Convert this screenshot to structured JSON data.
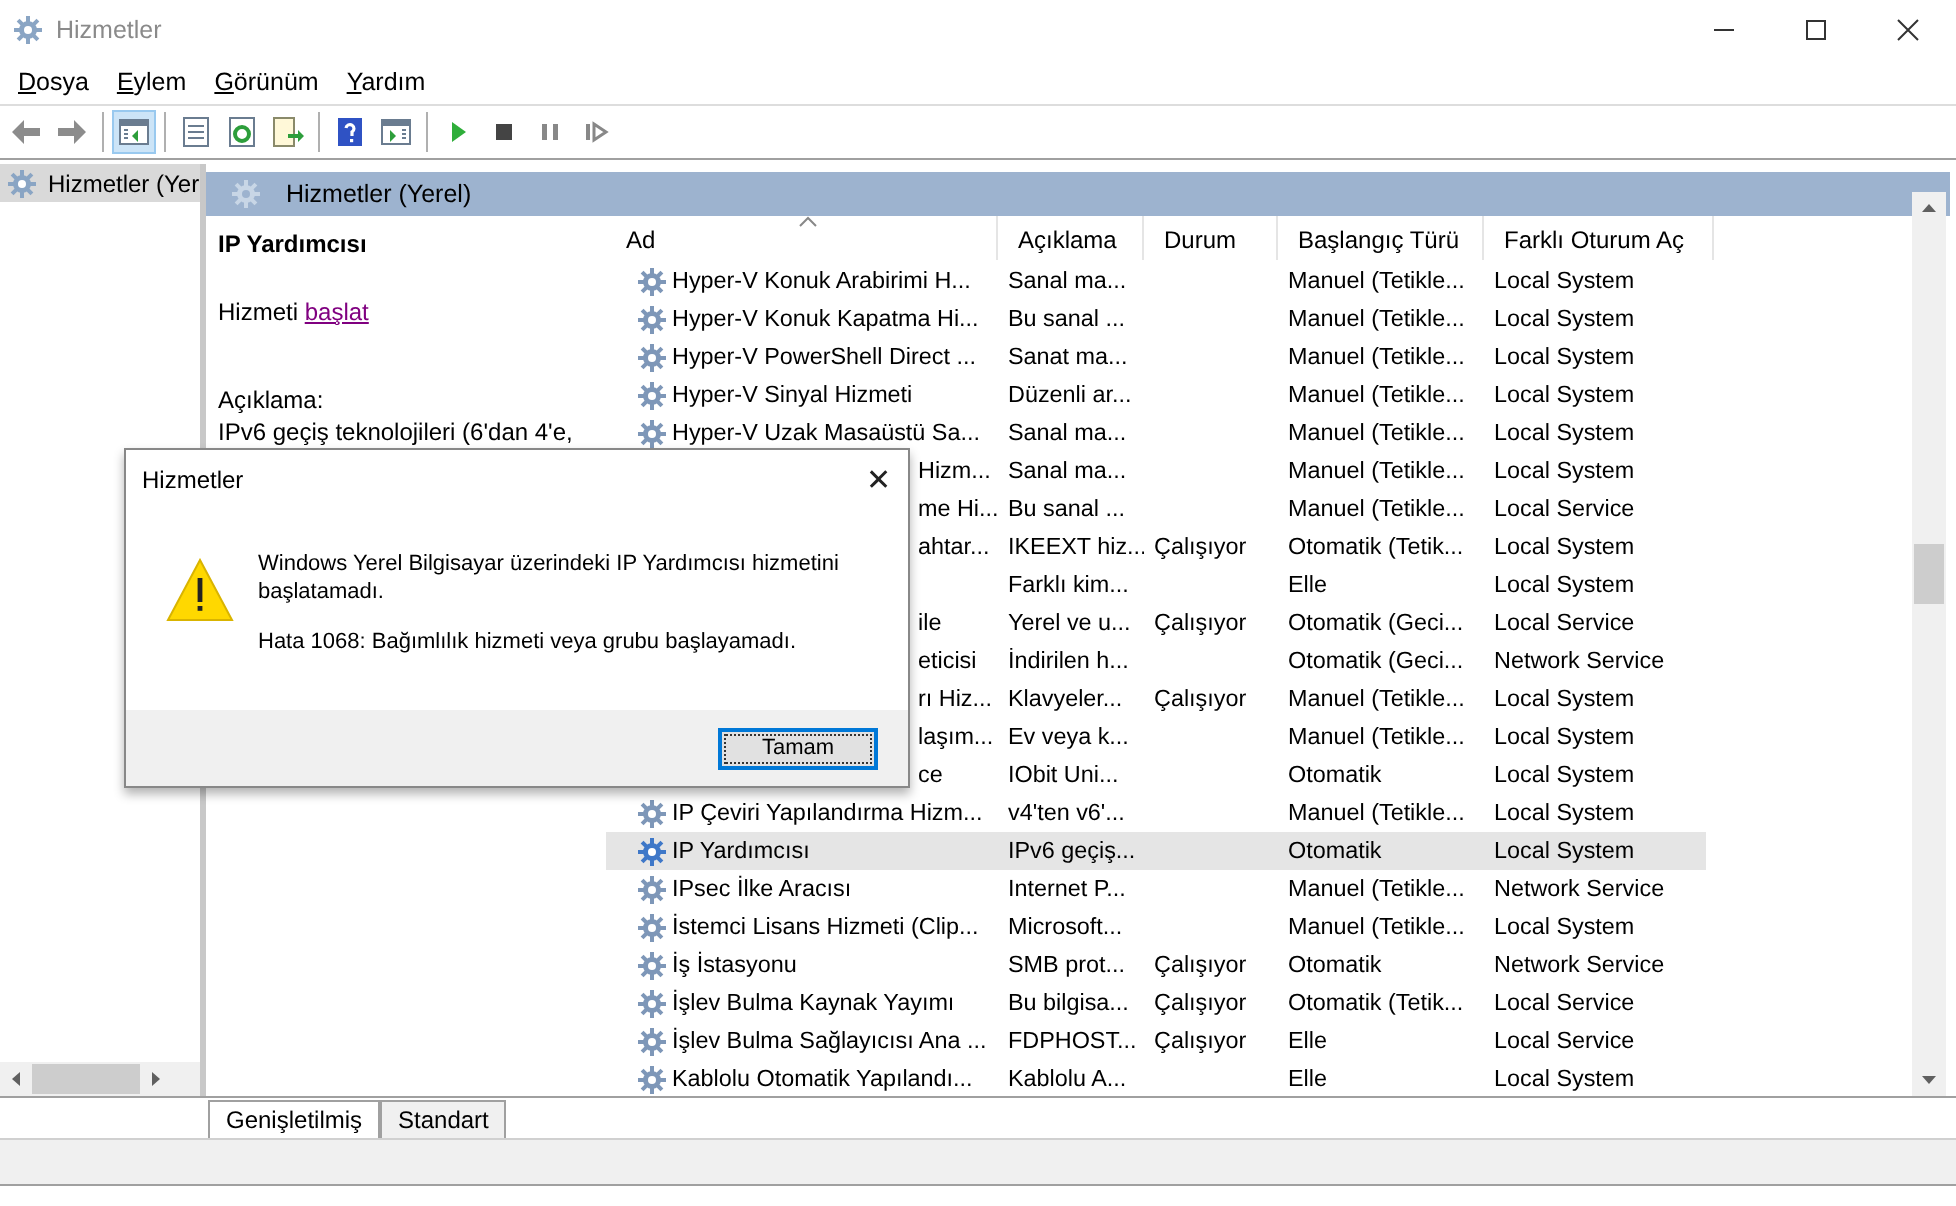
{
  "window": {
    "title": "Hizmetler"
  },
  "menu": [
    {
      "label": "Dosya"
    },
    {
      "label": "Eylem"
    },
    {
      "label": "Görünüm"
    },
    {
      "label": "Yardım"
    }
  ],
  "toolbar": [
    {
      "kind": "back",
      "pressed": false
    },
    {
      "kind": "forward",
      "pressed": false
    },
    {
      "kind": "sep"
    },
    {
      "kind": "tree",
      "pressed": true
    },
    {
      "kind": "sep"
    },
    {
      "kind": "properties",
      "pressed": false
    },
    {
      "kind": "refresh",
      "pressed": false
    },
    {
      "kind": "export",
      "pressed": false
    },
    {
      "kind": "sep"
    },
    {
      "kind": "help",
      "pressed": false
    },
    {
      "kind": "pane",
      "pressed": false
    },
    {
      "kind": "sep"
    },
    {
      "kind": "play",
      "pressed": false
    },
    {
      "kind": "stop",
      "pressed": false
    },
    {
      "kind": "pause",
      "pressed": false
    },
    {
      "kind": "resume",
      "pressed": false
    }
  ],
  "tree": {
    "items": [
      {
        "label": "Hizmetler (Yer",
        "selected": true
      }
    ]
  },
  "pane_header": "Hizmetler (Yerel)",
  "details": {
    "title": "IP Yardımcısı",
    "action_prefix": "Hizmeti",
    "action_link": "başlat",
    "description_label": "Açıklama:",
    "description": "IPv6 geçiş teknolojileri (6'dan 4'e,"
  },
  "table": {
    "columns": [
      "Ad",
      "Açıklama",
      "Durum",
      "Başlangıç Türü",
      "Farklı Oturum Aç"
    ],
    "rows": [
      {
        "kind": "service",
        "name": "Hyper-V Konuk Arabirimi H...",
        "description": "Sanal ma...",
        "status": "",
        "startup": "Manuel (Tetikle...",
        "logon": "Local System",
        "selected": false
      },
      {
        "kind": "service",
        "name": "Hyper-V Konuk Kapatma Hi...",
        "description": "Bu sanal ...",
        "status": "",
        "startup": "Manuel (Tetikle...",
        "logon": "Local System",
        "selected": false
      },
      {
        "kind": "service",
        "name": "Hyper-V PowerShell Direct ...",
        "description": "Sanat ma...",
        "status": "",
        "startup": "Manuel (Tetikle...",
        "logon": "Local System",
        "selected": false
      },
      {
        "kind": "service",
        "name": "Hyper-V Sinyal Hizmeti",
        "description": "Düzenli ar...",
        "status": "",
        "startup": "Manuel (Tetikle...",
        "logon": "Local System",
        "selected": false
      },
      {
        "kind": "service",
        "name": "Hyper-V Uzak Masaüstü Sa...",
        "description": "Sanal ma...",
        "status": "",
        "startup": "Manuel (Tetikle...",
        "logon": "Local System",
        "selected": false
      },
      {
        "kind": "covered",
        "name": "Hizm...",
        "description": "Sanal ma...",
        "status": "",
        "startup": "Manuel (Tetikle...",
        "logon": "Local System",
        "selected": false
      },
      {
        "kind": "covered",
        "name": "me Hi...",
        "description": "Bu sanal ...",
        "status": "",
        "startup": "Manuel (Tetikle...",
        "logon": "Local Service",
        "selected": false
      },
      {
        "kind": "covered",
        "name": "ahtar...",
        "description": "IKEEXT hiz...",
        "status": "Çalışıyor",
        "startup": "Otomatik (Tetik...",
        "logon": "Local System",
        "selected": false
      },
      {
        "kind": "covered",
        "description": "Farklı kim...",
        "status": "",
        "startup": "Elle",
        "logon": "Local System",
        "selected": false
      },
      {
        "kind": "covered",
        "name": "ile",
        "description": "Yerel ve u...",
        "status": "Çalışıyor",
        "startup": "Otomatik (Geci...",
        "logon": "Local Service",
        "selected": false
      },
      {
        "kind": "covered",
        "name": "eticisi",
        "description": "İndirilen h...",
        "status": "",
        "startup": "Otomatik (Geci...",
        "logon": "Network Service",
        "selected": false
      },
      {
        "kind": "covered",
        "name": "rı Hiz...",
        "description": "Klavyeler...",
        "status": "Çalışıyor",
        "startup": "Manuel (Tetikle...",
        "logon": "Local System",
        "selected": false
      },
      {
        "kind": "covered",
        "name": "laşım...",
        "description": "Ev veya k...",
        "status": "",
        "startup": "Manuel (Tetikle...",
        "logon": "Local System",
        "selected": false
      },
      {
        "kind": "covered",
        "name": "ce",
        "description": "IObit Uni...",
        "status": "",
        "startup": "Otomatik",
        "logon": "Local System",
        "selected": false
      },
      {
        "kind": "service",
        "name": "IP Çeviri Yapılandırma Hizm...",
        "description": "v4'ten v6'...",
        "status": "",
        "startup": "Manuel (Tetikle...",
        "logon": "Local System",
        "selected": false
      },
      {
        "kind": "service",
        "name": "IP Yardımcısı",
        "description": "IPv6 geçiş...",
        "status": "",
        "startup": "Otomatik",
        "logon": "Local System",
        "selected": true
      },
      {
        "kind": "service",
        "name": "IPsec İlke Aracısı",
        "description": "Internet P...",
        "status": "",
        "startup": "Manuel (Tetikle...",
        "logon": "Network Service",
        "selected": false
      },
      {
        "kind": "service",
        "name": "İstemci Lisans Hizmeti (Clip...",
        "description": "Microsoft...",
        "status": "",
        "startup": "Manuel (Tetikle...",
        "logon": "Local System",
        "selected": false
      },
      {
        "kind": "service",
        "name": "İş İstasyonu",
        "description": "SMB prot...",
        "status": "Çalışıyor",
        "startup": "Otomatik",
        "logon": "Network Service",
        "selected": false
      },
      {
        "kind": "service",
        "name": "İşlev Bulma Kaynak Yayımı",
        "description": "Bu bilgisa...",
        "status": "Çalışıyor",
        "startup": "Otomatik (Tetik...",
        "logon": "Local Service",
        "selected": false
      },
      {
        "kind": "service",
        "name": "İşlev Bulma Sağlayıcısı Ana ...",
        "description": "FDPHOST...",
        "status": "Çalışıyor",
        "startup": "Elle",
        "logon": "Local Service",
        "selected": false
      },
      {
        "kind": "service",
        "name": "Kablolu Otomatik Yapılandı...",
        "description": "Kablolu A...",
        "status": "",
        "startup": "Elle",
        "logon": "Local System",
        "selected": false
      }
    ]
  },
  "bottom_tabs": [
    {
      "label": "Genişletilmiş",
      "selected": true
    },
    {
      "label": "Standart",
      "selected": false
    }
  ],
  "dialog": {
    "title": "Hizmetler",
    "close": "✕",
    "message": "Windows Yerel Bilgisayar üzerindeki IP Yardımcısı hizmetini başlatamadı.",
    "error": "Hata 1068: Bağımlılık hizmeti veya grubu başlayamadı.",
    "button": "Tamam"
  }
}
